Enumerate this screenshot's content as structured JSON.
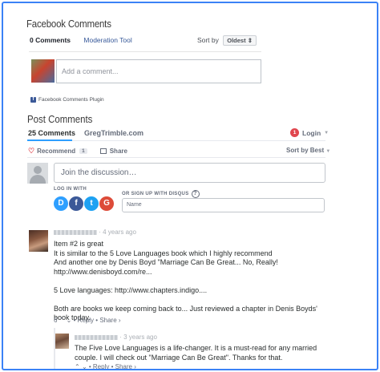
{
  "facebook": {
    "title": "Facebook Comments",
    "comment_count": "0 Comments",
    "moderation_tool": "Moderation Tool",
    "sort_label": "Sort by",
    "sort_value": "Oldest",
    "sort_caret": "⇕",
    "input_placeholder": "Add a comment...",
    "plugin_label": "Facebook Comments Plugin"
  },
  "post_comments": {
    "title": "Post Comments",
    "tab_count": "25 Comments",
    "site_name": "GregTrimble.com",
    "login_badge": "1",
    "login_label": "Login",
    "recommend_label": "Recommend",
    "recommend_count": "1",
    "share_label": "Share",
    "sort_label": "Sort by Best",
    "join_placeholder": "Join the discussion…",
    "log_in_with": "LOG IN WITH",
    "or_sign_up": "OR SIGN UP WITH DISQUS",
    "name_placeholder": "Name",
    "social_icons": [
      "D",
      "f",
      "t",
      "G"
    ],
    "accent_color": "#2e9fff"
  },
  "comments": [
    {
      "time": "4 years ago",
      "lines": [
        "Item #2 is great",
        "It is similar to the 5 Love Languages book which I highly recommend",
        "And another one by Denis Boyd \"Marriage Can Be Great... No, Really!",
        "http://www.denisboyd.com/re...",
        "5 Love languages: http://www.chapters.indigo....",
        "Both are books we keep coming back to... Just reviewed a chapter in Denis Boyds' book today."
      ],
      "votes": "6",
      "reply": "Reply",
      "share": "Share ›"
    },
    {
      "time": "3 years ago",
      "lines": [
        "The Five Love Languages is a life-changer. It is a must-read for any married couple. I will check out \"Marriage Can Be Great\". Thanks for that."
      ],
      "votes": "",
      "reply": "Reply",
      "share": "Share ›"
    }
  ]
}
